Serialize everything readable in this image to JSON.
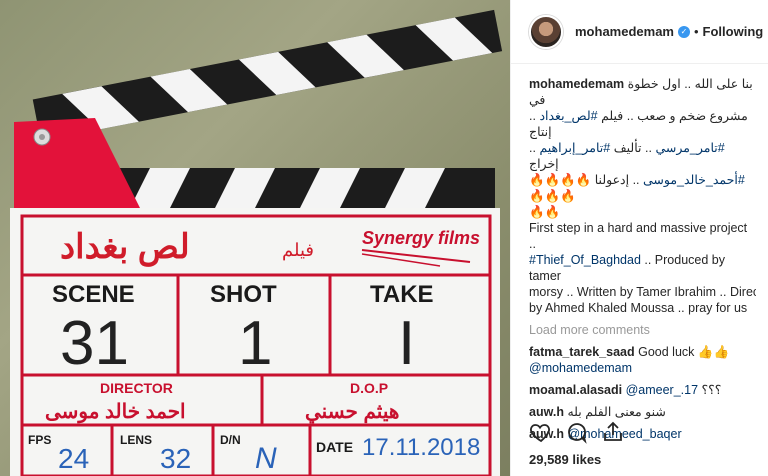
{
  "board": {
    "film_label": "فيلم",
    "title_ar": "لص بغداد",
    "company": "Synergy films",
    "scene_label": "SCENE",
    "shot_label": "SHOT",
    "take_label": "TAKE",
    "scene_value": "31",
    "shot_value": "1",
    "take_value": "I",
    "director_label": "DIRECTOR",
    "director_name": "احمد خالد موسى",
    "dop_label": "D.O.P",
    "dop_name": "هيثم حسني",
    "fps_label": "FPS",
    "fps_value": "24",
    "lens_label": "LENS",
    "lens_value": "32",
    "dn_label": "D/N",
    "dn_value": "N",
    "date_label": "DATE",
    "date_value": "17.11.2018"
  },
  "header": {
    "username": "mohamedemam",
    "verified_icon": "verified-check-icon",
    "separator": "•",
    "follow_status": "Following"
  },
  "caption": {
    "username": "mohamedemam",
    "line1": "بنا على الله .. اول خطوة في",
    "line2_a": "مشروع ضخم و صعب .. فيلم",
    "line2_tag": "#لص_بغداد",
    "line2_b": ".. إنتاج",
    "line3_tag1": "#تامر_مرسي",
    "line3_a": ".. تأليف",
    "line3_tag2": "#تامر_إبراهيم",
    "line3_b": ".. إخراج",
    "line4_tag": "#أحمد_خالد_موسى",
    "line4_a": ".. إدعولنا",
    "fire_row1": "🔥🔥🔥🔥🔥🔥🔥",
    "fire_row2": "🔥🔥",
    "en_line1": "First step in a hard and massive project ..",
    "en_tag": "#Thief_Of_Baghdad",
    "en_line2": ".. Produced by tamer",
    "en_line3": "morsy .. Written by Tamer Ibrahim .. Directed",
    "en_line4": "by Ahmed Khaled Moussa .. pray for us"
  },
  "load_more": "Load more comments",
  "comments": [
    {
      "user": "fatma_tarek_saad",
      "text": "Good luck",
      "emoji": "👍👍",
      "mention": "@mohamedemam"
    },
    {
      "user": "moamal.alasadi",
      "mention": "@ameer_.17",
      "text": "؟؟؟"
    },
    {
      "user": "auw.h",
      "text": "شنو معنى الفلم بله"
    },
    {
      "user": "auw.h",
      "mention": "@mohameed_baqer"
    }
  ],
  "actions": {
    "like_icon": "heart-icon",
    "comment_icon": "comment-bubble-icon",
    "share_icon": "share-icon"
  },
  "likes": "29,589 likes"
}
